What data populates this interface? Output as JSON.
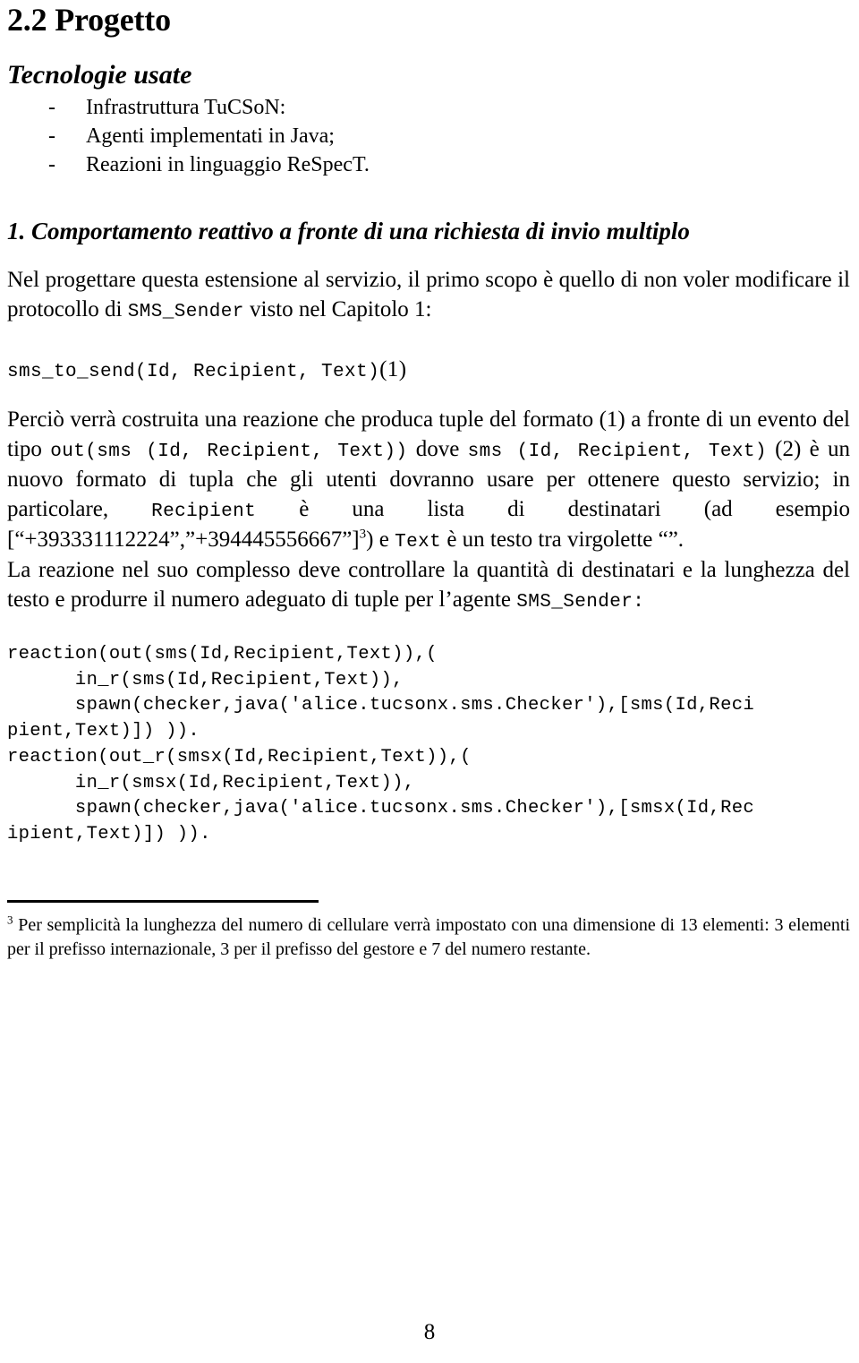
{
  "document": {
    "section_heading": "2.2 Progetto",
    "subsection_heading": "Tecnologie usate",
    "technologies": [
      {
        "dash": "-",
        "label": "Infrastruttura TuCSoN:"
      },
      {
        "dash": "-",
        "label": "Agenti implementati in Java;"
      },
      {
        "dash": "-",
        "label": "Reazioni in linguaggio ReSpecT."
      }
    ],
    "numbered_heading": "1. Comportamento reattivo a fronte di una richiesta di invio multiplo",
    "paragraph1": {
      "part1": "Nel progettare questa estensione al servizio, il primo scopo è quello di non voler modificare il protocollo di ",
      "code1": "SMS_Sender",
      "part2": " visto nel Capitolo 1:"
    },
    "equation1": {
      "code": "sms_to_send(Id, Recipient, Text)",
      "number": "(1)"
    },
    "paragraph2": {
      "p1": "Perciò verrà costruita una reazione che produca tuple del formato (1) a fronte di un evento del tipo ",
      "c1": "out(sms (Id, Recipient, Text))",
      "p2": " dove ",
      "c2": "sms (Id, Recipient, Text)",
      "n2": " (2)",
      "p3": " è un nuovo formato di tupla che gli utenti dovranno usare per ottenere questo servizio; in particolare, ",
      "c3": "Recipient",
      "p4": " è una lista di destinatari (ad esempio [“+393331112224”,”+394445556667”]",
      "footnote_marker": "3",
      "p5": ") e ",
      "c4": "Text",
      "p6": " è un testo tra virgolette “”."
    },
    "paragraph3": {
      "p1": "La reazione nel suo complesso deve controllare la quantità di destinatari e la lunghezza del testo e produrre il numero adeguato di tuple per l’agente ",
      "c1": "SMS_Sender",
      "p2": ":"
    },
    "code_block": "reaction(out(sms(Id,Recipient,Text)),(\n      in_r(sms(Id,Recipient,Text)),\n      spawn(checker,java('alice.tucsonx.sms.Checker'),[sms(Id,Reci\npient,Text)]) )).\nreaction(out_r(smsx(Id,Recipient,Text)),(\n      in_r(smsx(Id,Recipient,Text)),\n      spawn(checker,java('alice.tucsonx.sms.Checker'),[smsx(Id,Rec\nipient,Text)]) )).",
    "footnote": {
      "marker": "3",
      "text": " Per semplicità  la lunghezza del numero di cellulare verrà impostato con una dimensione di 13 elementi: 3 elementi per il prefisso internazionale, 3 per il prefisso del gestore e 7 del numero restante."
    },
    "page_number": "8"
  }
}
